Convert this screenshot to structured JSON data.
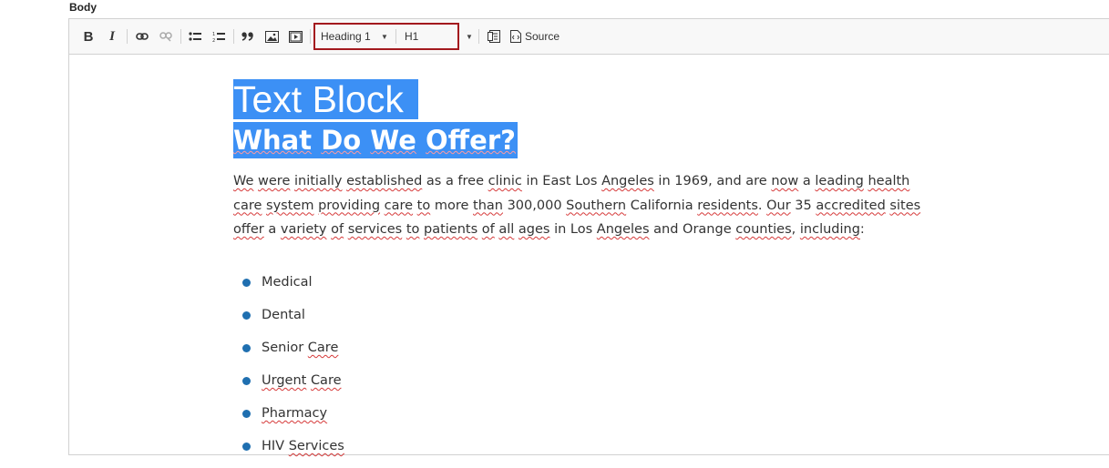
{
  "field_label": "Body",
  "toolbar": {
    "bold": "B",
    "italic": "I",
    "format_value": "Heading 1",
    "style_value": "H1",
    "source_label": "Source"
  },
  "content": {
    "heading1": "Text Block",
    "heading2_words": [
      "What",
      "Do",
      "We",
      "Offer?"
    ],
    "paragraph_segments": [
      {
        "t": "We",
        "sp": true
      },
      {
        "t": " "
      },
      {
        "t": "were",
        "sp": true
      },
      {
        "t": " "
      },
      {
        "t": "initially",
        "sp": true
      },
      {
        "t": " "
      },
      {
        "t": "established",
        "sp": true
      },
      {
        "t": " as a free "
      },
      {
        "t": "clinic",
        "sp": true
      },
      {
        "t": " in East Los "
      },
      {
        "t": "Angeles",
        "sp": true
      },
      {
        "t": " in 1969, and are "
      },
      {
        "t": "now",
        "sp": true
      },
      {
        "t": " a "
      },
      {
        "t": "leading",
        "sp": true
      },
      {
        "t": " "
      },
      {
        "t": "health",
        "sp": true
      },
      {
        "t": " "
      },
      {
        "t": "care",
        "sp": true
      },
      {
        "t": " "
      },
      {
        "t": "system",
        "sp": true
      },
      {
        "t": " "
      },
      {
        "t": "providing",
        "sp": true
      },
      {
        "t": " "
      },
      {
        "t": "care",
        "sp": true
      },
      {
        "t": " "
      },
      {
        "t": "to",
        "sp": true
      },
      {
        "t": " more "
      },
      {
        "t": "than",
        "sp": true
      },
      {
        "t": " 300,000 "
      },
      {
        "t": "Southern",
        "sp": true
      },
      {
        "t": " California "
      },
      {
        "t": "residents",
        "sp": true
      },
      {
        "t": ". "
      },
      {
        "t": "Our",
        "sp": true
      },
      {
        "t": " 35 "
      },
      {
        "t": "accredited",
        "sp": true
      },
      {
        "t": " "
      },
      {
        "t": "sites",
        "sp": true
      },
      {
        "t": " "
      },
      {
        "t": "offer",
        "sp": true
      },
      {
        "t": " a "
      },
      {
        "t": "variety",
        "sp": true
      },
      {
        "t": " "
      },
      {
        "t": "of",
        "sp": true
      },
      {
        "t": " "
      },
      {
        "t": "services",
        "sp": true
      },
      {
        "t": " "
      },
      {
        "t": "to",
        "sp": true
      },
      {
        "t": " "
      },
      {
        "t": "patients",
        "sp": true
      },
      {
        "t": " "
      },
      {
        "t": "of",
        "sp": true
      },
      {
        "t": " "
      },
      {
        "t": "all",
        "sp": true
      },
      {
        "t": " "
      },
      {
        "t": "ages",
        "sp": true
      },
      {
        "t": " in Los "
      },
      {
        "t": "Angeles",
        "sp": true
      },
      {
        "t": " and Orange "
      },
      {
        "t": "counties",
        "sp": true
      },
      {
        "t": ", "
      },
      {
        "t": "including",
        "sp": true
      },
      {
        "t": ":"
      }
    ],
    "list_items": [
      {
        "segments": [
          {
            "t": "Medical"
          }
        ]
      },
      {
        "segments": [
          {
            "t": "Dental"
          }
        ]
      },
      {
        "segments": [
          {
            "t": "Senior "
          },
          {
            "t": "Care",
            "sp": true
          }
        ]
      },
      {
        "segments": [
          {
            "t": "Urgent",
            "sp": true
          },
          {
            "t": " "
          },
          {
            "t": "Care",
            "sp": true
          }
        ]
      },
      {
        "segments": [
          {
            "t": "Pharmacy",
            "sp": true
          }
        ]
      },
      {
        "segments": [
          {
            "t": "HIV "
          },
          {
            "t": "Services",
            "sp": true
          }
        ]
      }
    ]
  },
  "colors": {
    "selection": "#3c90f5",
    "bullet": "#1f6fb0",
    "highlight_border": "#a3191e",
    "spellcheck": "#d63a3a"
  }
}
